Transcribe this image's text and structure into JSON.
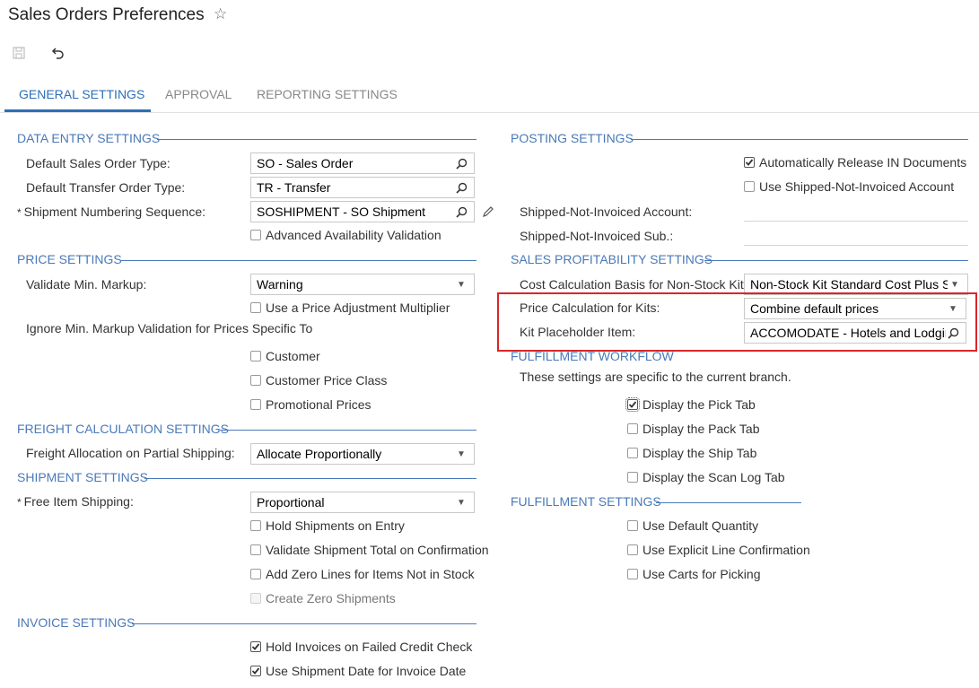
{
  "header": {
    "title": "Sales Orders Preferences"
  },
  "icons": {
    "star": "star-icon",
    "save": "save-icon",
    "undo": "undo-icon"
  },
  "tabs": [
    {
      "label": "GENERAL SETTINGS"
    },
    {
      "label": "APPROVAL"
    },
    {
      "label": "REPORTING SETTINGS"
    }
  ],
  "data_entry": {
    "header": "DATA ENTRY SETTINGS",
    "sales_order_type_label": "Default Sales Order Type:",
    "sales_order_type_value": "SO - Sales Order",
    "transfer_order_type_label": "Default Transfer Order Type:",
    "transfer_order_type_value": "TR - Transfer",
    "shipment_numbering_label": "Shipment Numbering Sequence:",
    "shipment_numbering_value": "SOSHIPMENT - SO Shipment",
    "advanced_availability_label": "Advanced Availability Validation"
  },
  "price": {
    "header": "PRICE SETTINGS",
    "validate_markup_label": "Validate Min. Markup:",
    "validate_markup_value": "Warning",
    "price_adj_label": "Use a Price Adjustment Multiplier",
    "ignore_label": "Ignore Min. Markup Validation for Prices Specific To",
    "customer_label": "Customer",
    "customer_class_label": "Customer Price Class",
    "promo_label": "Promotional Prices"
  },
  "freight": {
    "header": "FREIGHT CALCULATION SETTINGS",
    "allocation_label": "Freight Allocation on Partial Shipping:",
    "allocation_value": "Allocate Proportionally"
  },
  "shipment": {
    "header": "SHIPMENT SETTINGS",
    "free_item_label": "Free Item Shipping:",
    "free_item_value": "Proportional",
    "hold_label": "Hold Shipments on Entry",
    "validate_total_label": "Validate Shipment Total on Confirmation",
    "zero_lines_label": "Add Zero Lines for Items Not in Stock",
    "zero_shipments_label": "Create Zero Shipments"
  },
  "invoice": {
    "header": "INVOICE SETTINGS",
    "hold_failed_label": "Hold Invoices on Failed Credit Check",
    "use_shipment_date_label": "Use Shipment Date for Invoice Date"
  },
  "posting": {
    "header": "POSTING SETTINGS",
    "auto_release_label": "Automatically Release IN Documents",
    "use_sni_label": "Use Shipped-Not-Invoiced Account",
    "sni_account_label": "Shipped-Not-Invoiced Account:",
    "sni_sub_label": "Shipped-Not-Invoiced Sub.:"
  },
  "profitability": {
    "header": "SALES PROFITABILITY SETTINGS",
    "cost_basis_label": "Cost Calculation Basis for Non-Stock Kits:",
    "cost_basis_value": "Non-Stock Kit Standard Cost Plus Stoc",
    "price_calc_label": "Price Calculation for Kits:",
    "price_calc_value": "Combine default prices",
    "kit_item_label": "Kit Placeholder Item:",
    "kit_item_value": "ACCOMODATE - Hotels and Lodging"
  },
  "workflow": {
    "header": "FULFILLMENT WORKFLOW",
    "note": "These settings are specific to the current branch.",
    "pick_label": "Display the Pick Tab",
    "pack_label": "Display the Pack Tab",
    "ship_label": "Display the Ship Tab",
    "scan_log_label": "Display the Scan Log Tab"
  },
  "fulfillment": {
    "header": "FULFILLMENT SETTINGS",
    "default_qty_label": "Use Default Quantity",
    "explicit_label": "Use Explicit Line Confirmation",
    "carts_label": "Use Carts for Picking"
  },
  "colors": {
    "accent": "#2c6fb7",
    "section": "#4a79b8",
    "highlight": "#d9262a"
  }
}
